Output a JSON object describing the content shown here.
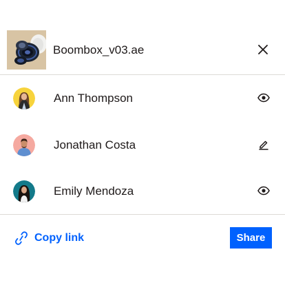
{
  "file": {
    "name": "Boombox_v03.ae",
    "thumbnail_icon": "speaker-thumbnail"
  },
  "close_icon": "close-icon",
  "people": [
    {
      "name": "Ann Thompson",
      "permission_icon": "eye-icon",
      "avatar_bg": "#f7d33c"
    },
    {
      "name": "Jonathan Costa",
      "permission_icon": "pencil-icon",
      "avatar_bg": "#f5a9a0"
    },
    {
      "name": "Emily Mendoza",
      "permission_icon": "eye-icon",
      "avatar_bg": "#137a8a"
    }
  ],
  "footer": {
    "copy_link_label": "Copy link",
    "share_label": "Share"
  },
  "colors": {
    "accent": "#0061fe",
    "text": "#1e1919",
    "divider": "#dddad6",
    "thumbnail_bg": "#d8c4a4"
  }
}
